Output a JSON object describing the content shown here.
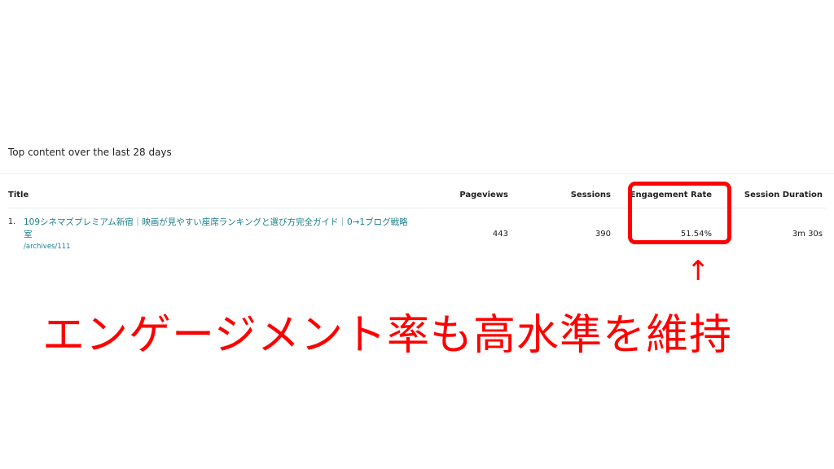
{
  "section_title": "Top content over the last 28 days",
  "table": {
    "columns": {
      "title": "Title",
      "pageviews": "Pageviews",
      "sessions": "Sessions",
      "engagement_rate": "Engagement Rate",
      "session_duration": "Session Duration"
    },
    "rows": [
      {
        "index": "1.",
        "title": "109シネマズプレミアム新宿｜映画が見やすい座席ランキングと選び方完全ガイド｜0→1ブログ戦略室",
        "path": "/archives/111",
        "pageviews": "443",
        "sessions": "390",
        "engagement_rate": "51.54%",
        "session_duration": "3m 30s"
      }
    ]
  },
  "annotation": {
    "arrow": "↑",
    "caption": "エンゲージメント率も高水準を維持",
    "color": "#ff0000"
  }
}
